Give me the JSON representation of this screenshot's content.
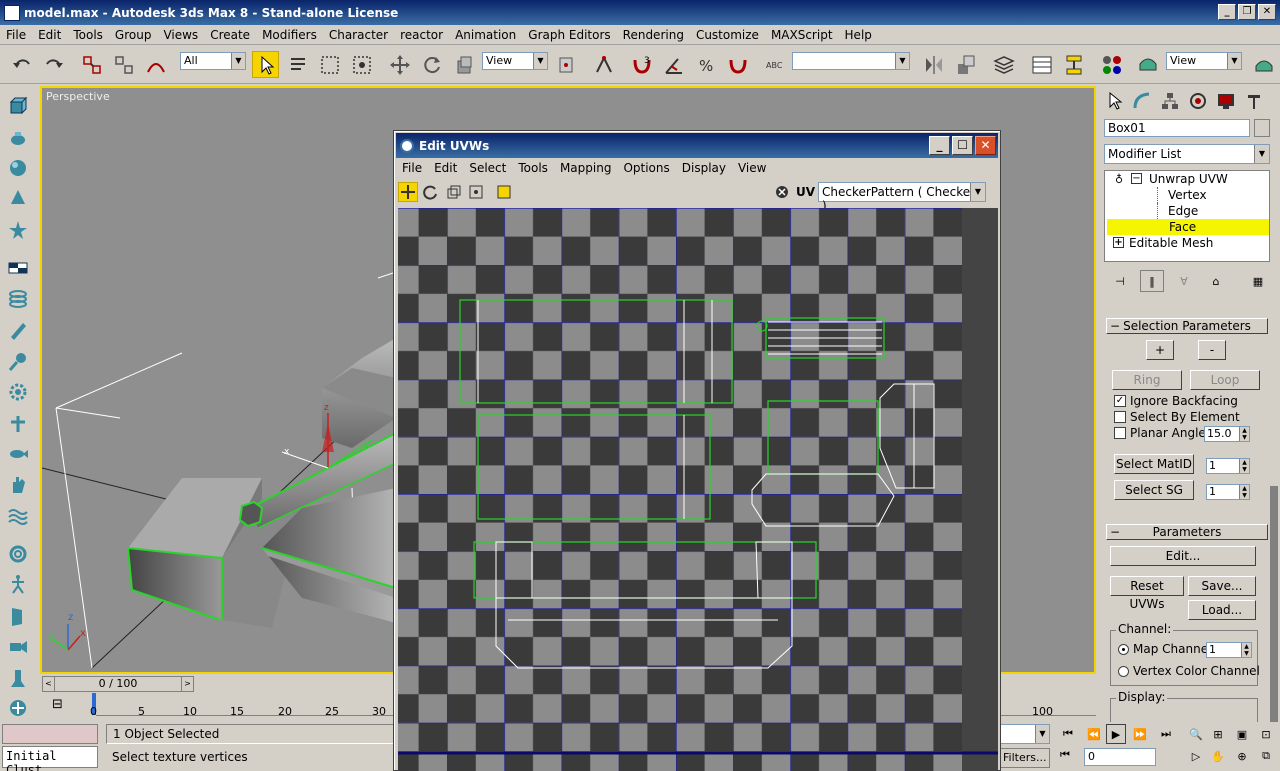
{
  "app": {
    "title": "model.max - Autodesk 3ds Max 8  - Stand-alone License"
  },
  "menu": [
    "File",
    "Edit",
    "Tools",
    "Group",
    "Views",
    "Create",
    "Modifiers",
    "Character",
    "reactor",
    "Animation",
    "Graph Editors",
    "Rendering",
    "Customize",
    "MAXScript",
    "Help"
  ],
  "toolbar": {
    "selection_filter": "All",
    "ref_coord": "View",
    "named_selection": "",
    "render_view": "View"
  },
  "viewport": {
    "label": "Perspective",
    "axis_x": "x",
    "axis_y": "y",
    "axis_z": "z"
  },
  "timeline": {
    "frame": "0 / 100",
    "ticks": [
      "0",
      "5",
      "10",
      "15",
      "20",
      "25",
      "30",
      "100"
    ]
  },
  "status": {
    "maxscript": "Initial Clust",
    "selected": "1 Object Selected",
    "prompt": "Select texture vertices",
    "frame_field": "0",
    "filters": "Filters..."
  },
  "panel": {
    "object_name": "Box01",
    "modifier_list": "Modifier List",
    "stack": [
      "Unwrap UVW",
      "Vertex",
      "Edge",
      "Face",
      "Editable Mesh"
    ],
    "selection_params": {
      "title": "Selection Parameters",
      "plus": "+",
      "minus": "-",
      "ring": "Ring",
      "loop": "Loop",
      "ignore_backfacing": "Ignore Backfacing",
      "select_by_element": "Select By Element",
      "planar_angle": "Planar Angle",
      "planar_angle_value": "15.0",
      "select_matid": "Select MatID",
      "matid_value": "1",
      "select_sg": "Select SG",
      "sg_value": "1"
    },
    "parameters": {
      "title": "Parameters",
      "edit": "Edit...",
      "reset": "Reset UVWs",
      "save": "Save...",
      "load": "Load...",
      "channel": "Channel:",
      "map_channel": "Map Channel:",
      "map_channel_value": "1",
      "vertex_color": "Vertex Color Channel",
      "display": "Display:"
    }
  },
  "uv_editor": {
    "title": "Edit UVWs",
    "menu": [
      "File",
      "Edit",
      "Select",
      "Tools",
      "Mapping",
      "Options",
      "Display",
      "View"
    ],
    "uv_label": "UV",
    "texture": "CheckerPattern  ( Checker )"
  }
}
